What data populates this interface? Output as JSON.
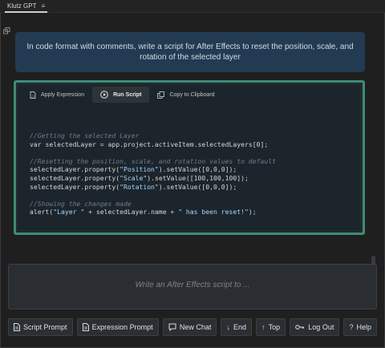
{
  "panel": {
    "tab_label": "Klutz GPT",
    "menu_glyph": "≡"
  },
  "prompt": {
    "text": "In code format with comments, write a script for After Effects to reset the position, scale, and rotation of the selected layer"
  },
  "toolbar": {
    "apply_expression": "Apply Expression",
    "run_script": "Run Script",
    "copy_clipboard": "Copy to Clipboard"
  },
  "code_lines": [
    "//Getting the selected Layer",
    "var selectedLayer = app.project.activeItem.selectedLayers[0];",
    "",
    "//Resetting the position, scale, and rotation values to default",
    "selectedLayer.property(\"Position\").setValue([0,0,0]);",
    "selectedLayer.property(\"Scale\").setValue([100,100,100]);",
    "selectedLayer.property(\"Rotation\").setValue([0,0,0]);",
    "",
    "//Showing the changes made",
    "alert(\"Layer \" + selectedLayer.name + \" has been reset!\");"
  ],
  "input": {
    "placeholder": "Write an After Effects script to ..."
  },
  "buttons": {
    "script_prompt": "Script Prompt",
    "expression_prompt": "Expression Prompt",
    "new_chat": "New Chat",
    "end": "End",
    "top": "Top",
    "log_out": "Log Out",
    "help": "Help"
  },
  "colors": {
    "accent_border": "#3d8c74",
    "prompt_bg": "#223b52"
  }
}
